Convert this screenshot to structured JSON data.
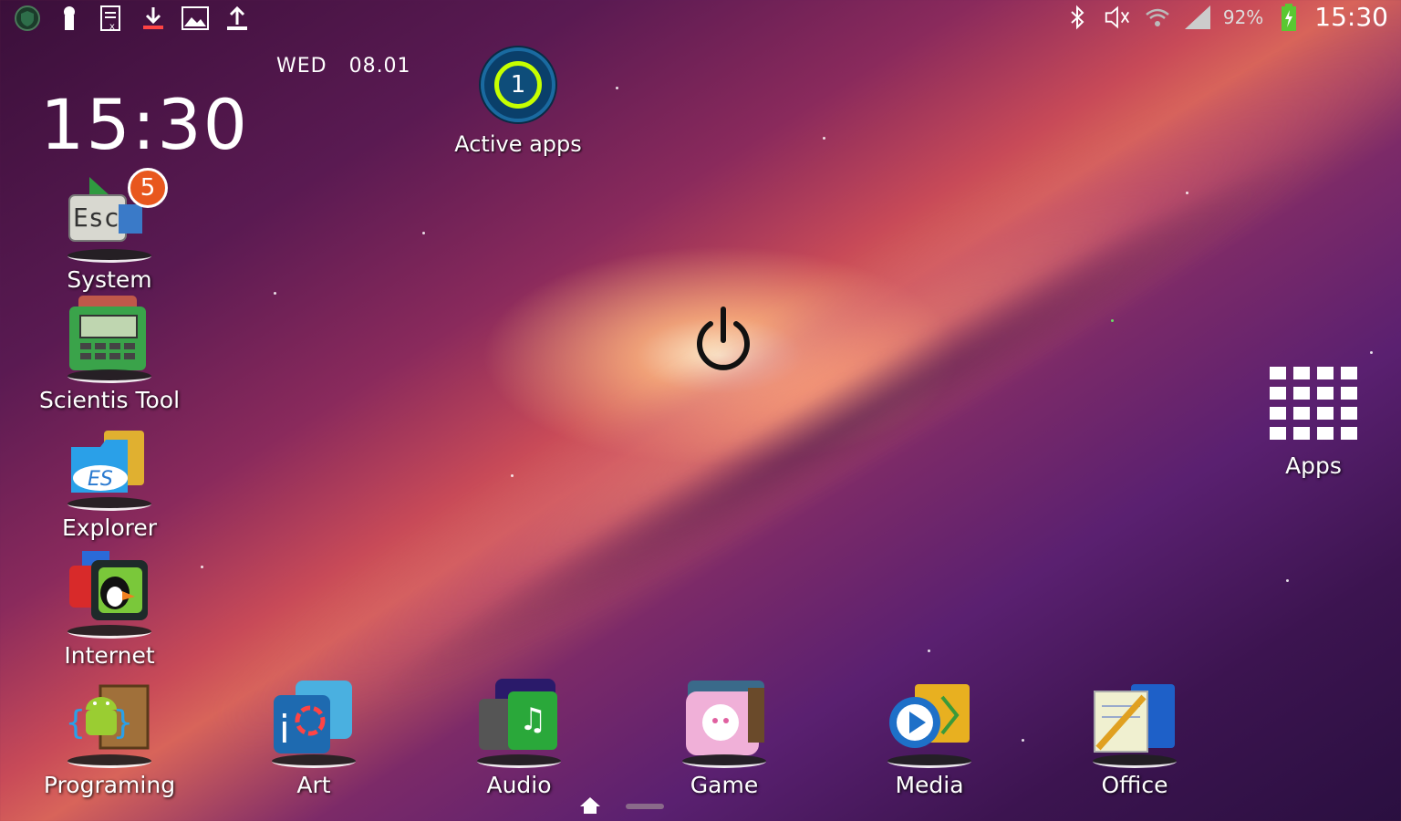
{
  "status_bar": {
    "battery_percent": "92%",
    "time": "15:30",
    "left_icons": [
      "shield-icon",
      "keyhole-icon",
      "document-icon",
      "download-icon",
      "image-icon",
      "upload-icon"
    ],
    "right_icons": [
      "bluetooth-icon",
      "mute-icon",
      "wifi-icon",
      "signal-icon",
      "battery-charging-icon"
    ]
  },
  "clock_widget": {
    "date": "WED   08.01",
    "time": "15:30"
  },
  "active_apps": {
    "count": "1",
    "label": "Active apps"
  },
  "left_dock": [
    {
      "label": "System",
      "badge": "5"
    },
    {
      "label": "Scientis Tool"
    },
    {
      "label": "Explorer"
    },
    {
      "label": "Internet"
    }
  ],
  "bottom_dock": [
    {
      "label": "Programing"
    },
    {
      "label": "Art"
    },
    {
      "label": "Audio"
    },
    {
      "label": "Game"
    },
    {
      "label": "Media"
    },
    {
      "label": "Office"
    }
  ],
  "apps_button": {
    "label": "Apps"
  },
  "colors": {
    "badge": "#e8571e",
    "active_ring": "#c6ff00",
    "battery": "#5ac832"
  }
}
